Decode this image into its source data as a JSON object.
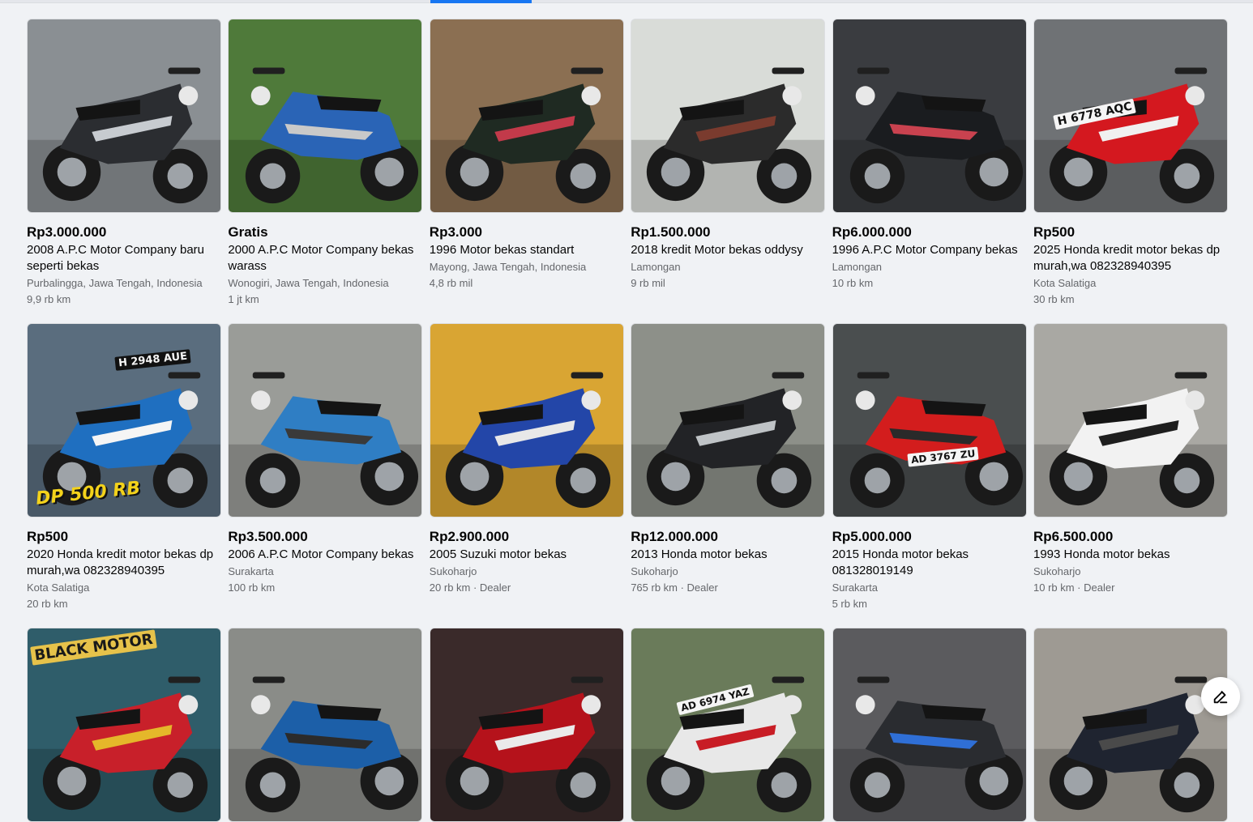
{
  "listings": [
    {
      "price": "Rp3.000.000",
      "title": "2008 A.P.C Motor Company baru seperti bekas",
      "location": "Purbalingga, Jawa Tengah, Indonesia",
      "mileage": "9,9 rb km",
      "colors": {
        "bg": "#8a8f93",
        "bike": "#2b2d31",
        "accent": "#c7cbd0"
      }
    },
    {
      "price": "Gratis",
      "title": "2000 A.P.C Motor Company bekas warass",
      "location": "Wonogiri, Jawa Tengah, Indonesia",
      "mileage": "1 jt km",
      "colors": {
        "bg": "#4f7a3a",
        "bike": "#2a64b6",
        "accent": "#c9c9c9"
      }
    },
    {
      "price": "Rp3.000",
      "title": "1996 Motor bekas standart",
      "location": "Mayong, Jawa Tengah, Indonesia",
      "mileage": "4,8 rb mil",
      "colors": {
        "bg": "#8b6f52",
        "bike": "#1f2a22",
        "accent": "#c23a4a"
      }
    },
    {
      "price": "Rp1.500.000",
      "title": "2018 kredit Motor bekas oddysy",
      "location": "Lamongan",
      "mileage": "9 rb mil",
      "colors": {
        "bg": "#d9dcd8",
        "bike": "#2b2b2b",
        "accent": "#7a3b2e"
      }
    },
    {
      "price": "Rp6.000.000",
      "title": "1996 A.P.C Motor Company bekas",
      "location": "Lamongan",
      "mileage": "10 rb km",
      "colors": {
        "bg": "#3a3c40",
        "bike": "#1a1c1f",
        "accent": "#c9424f"
      }
    },
    {
      "price": "Rp500",
      "title": "2025 Honda kredit motor bekas dp murah,wa 082328940395",
      "location": "Kota Salatiga",
      "mileage": "30 rb km",
      "colors": {
        "bg": "#6f7275",
        "bike": "#d4181f",
        "accent": "#f0f0f0"
      }
    },
    {
      "price": "Rp500",
      "title": "2020 Honda kredit motor bekas dp murah,wa 082328940395",
      "location": "Kota Salatiga",
      "mileage": "20 rb km",
      "colors": {
        "bg": "#5a6d7e",
        "bike": "#1f6fc0",
        "accent": "#f5f5f5"
      }
    },
    {
      "price": "Rp3.500.000",
      "title": "2006 A.P.C Motor Company bekas",
      "location": "Surakarta",
      "mileage": "100 rb km",
      "colors": {
        "bg": "#9a9c98",
        "bike": "#2f7ec4",
        "accent": "#3a3a3a"
      }
    },
    {
      "price": "Rp2.900.000",
      "title": "2005 Suzuki motor bekas",
      "location": "Sukoharjo",
      "mileage": "20 rb km · Dealer",
      "colors": {
        "bg": "#d9a533",
        "bike": "#2346a8",
        "accent": "#e8e8e8"
      }
    },
    {
      "price": "Rp12.000.000",
      "title": "2013 Honda motor bekas",
      "location": "Sukoharjo",
      "mileage": "765 rb km · Dealer",
      "colors": {
        "bg": "#8d9089",
        "bike": "#222326",
        "accent": "#bfc3c6"
      }
    },
    {
      "price": "Rp5.000.000",
      "title": "2015 Honda motor bekas 081328019149",
      "location": "Surakarta",
      "mileage": "5 rb km",
      "colors": {
        "bg": "#4a4e4f",
        "bike": "#d31d1d",
        "accent": "#2a2a2a"
      }
    },
    {
      "price": "Rp6.500.000",
      "title": "1993 Honda motor bekas",
      "location": "Sukoharjo",
      "mileage": "10 rb km · Dealer",
      "colors": {
        "bg": "#a9a8a3",
        "bike": "#f2f2f2",
        "accent": "#1e1e1e"
      }
    },
    {
      "price": "",
      "title": "",
      "location": "",
      "mileage": "",
      "colors": {
        "bg": "#2f5d6a",
        "bike": "#c8202a",
        "accent": "#e5b72a"
      }
    },
    {
      "price": "",
      "title": "",
      "location": "",
      "mileage": "",
      "colors": {
        "bg": "#8a8c88",
        "bike": "#1c5fa8",
        "accent": "#2b2b2b"
      }
    },
    {
      "price": "",
      "title": "",
      "location": "",
      "mileage": "",
      "colors": {
        "bg": "#3a2a2a",
        "bike": "#b5121b",
        "accent": "#eaeaea"
      }
    },
    {
      "price": "",
      "title": "",
      "location": "",
      "mileage": "",
      "colors": {
        "bg": "#6a7b5a",
        "bike": "#e8e8e8",
        "accent": "#c81d25"
      }
    },
    {
      "price": "",
      "title": "",
      "location": "",
      "mileage": "",
      "colors": {
        "bg": "#5b5b5e",
        "bike": "#2a2c30",
        "accent": "#2f6fd6"
      }
    },
    {
      "price": "",
      "title": "",
      "location": "",
      "mileage": "",
      "colors": {
        "bg": "#9e9a93",
        "bike": "#1f2430",
        "accent": "#4a4a4a"
      }
    }
  ],
  "plates": {
    "card6": "H 6778 AQC",
    "card7": "H 2948 AUE",
    "card7_promo": "DP 500 RB",
    "card11": "AD 3767 ZU",
    "card13": "BLACK MOTOR",
    "card16": "AD 6974 YAZ"
  },
  "fab": {
    "icon": "compose-icon"
  }
}
